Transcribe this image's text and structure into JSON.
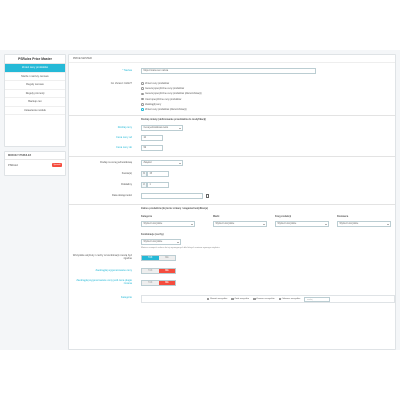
{
  "sidebar": {
    "title": "PSRulez Price Master",
    "items": [
      {
        "label": "Zmień ceny produktów",
        "active": true
      },
      {
        "label": "Marże i narzuty cenowe",
        "active": false
      },
      {
        "label": "Reguły cenowe",
        "active": false
      },
      {
        "label": "Reguły promocji",
        "active": false
      },
      {
        "label": "Backup cen",
        "active": false
      },
      {
        "label": "Ustawienia modułu",
        "active": false
      }
    ]
  },
  "modules": {
    "title": "Moduły PSRulez",
    "items": [
      {
        "label": "PSRulez",
        "badge": "Sprawdź"
      }
    ]
  },
  "main": {
    "header": "Price Master",
    "name": {
      "label": "* Nazwa",
      "value": "Moja zmiana cen nazwa"
    },
    "what": {
      "label": "Co chcesz zrobić?",
      "options": [
        {
          "label": "Zmień ceny produktów",
          "selected": false
        },
        {
          "label": "Generuj specyficzne ceny produktów",
          "selected": false
        },
        {
          "label": "Generuj specyficzne ceny produktów (dla kombinacji)",
          "selected": false
        },
        {
          "label": "Usuń specyficzne ceny produktów",
          "selected": false
        },
        {
          "label": "Zaokrąglij ceny",
          "selected": false
        },
        {
          "label": "Zmień ceny produktów (dla kombinacji)",
          "selected": true
        }
      ]
    },
    "modify_section": "Rodzaj zmiany (definiowanie przedziałów do modyfikacji)",
    "price_type": {
      "label": "Rodzaj ceny",
      "value": "Cena jednostkowa netto"
    },
    "price_from": {
      "label": "Cena ceny od",
      "value": "10"
    },
    "price_to": {
      "label": "Cena ceny do",
      "value": "99"
    },
    "change_type": {
      "label": "Dodaj na cenę jednostkową",
      "value": "Zwiększ"
    },
    "amount": {
      "label": "Kwota(s)",
      "prefix": "%",
      "value": "15"
    },
    "rounding": {
      "label": "Dokładny",
      "prefix": "zł",
      "value": "1"
    },
    "date": {
      "label": "Data dostępności",
      "value": ""
    },
    "filter_section": "Zakres produktów (kryteria: zmiany / waganie/modyfikacje)",
    "filter_cols": [
      {
        "title": "Kategorie",
        "value": "Wybierz wszystkie"
      },
      {
        "title": "Marki",
        "value": "Wybierz wszystkie"
      },
      {
        "title": "Kraj produkcji",
        "value": "Wybierz wszystkie"
      },
      {
        "title": "Dostawca",
        "value": "Wybierz wszystkie"
      }
    ],
    "combinations": {
      "title": "Kombinacje (cechy)",
      "value": "Wybierz wszystkie"
    },
    "combinations_note": "Możesz zawęzić zakres do tej wymaganych dla których zmiana wymaga atrybutu.",
    "attr_change": {
      "label": "Wszystkie atrybuty i cechy w kombinacji muszą być zgodne",
      "yes": "TAK",
      "no": "NIE",
      "value": "yes"
    },
    "round_up": {
      "label": "Zaokrąglaj wygenerowane ceny",
      "yes": "TAK",
      "no": "NIE",
      "value": "no"
    },
    "round_zero": {
      "label": "Zaokrąglaj wygenerowane ceny jeśli cena pługie zmiana",
      "yes": "TAK",
      "no": "NIE",
      "value": "no"
    },
    "categories": {
      "label": "Kategorie",
      "items": [
        "Rozwiń wszystkie",
        "Zwiń wszystkie",
        "Zaznacz wszystkie",
        "Odznacz wszystkie"
      ],
      "search_placeholder": "szukaj"
    }
  },
  "colors": {
    "accent": "#25b9d7",
    "danger": "#f54c3e",
    "background": "#f4f6f8"
  }
}
